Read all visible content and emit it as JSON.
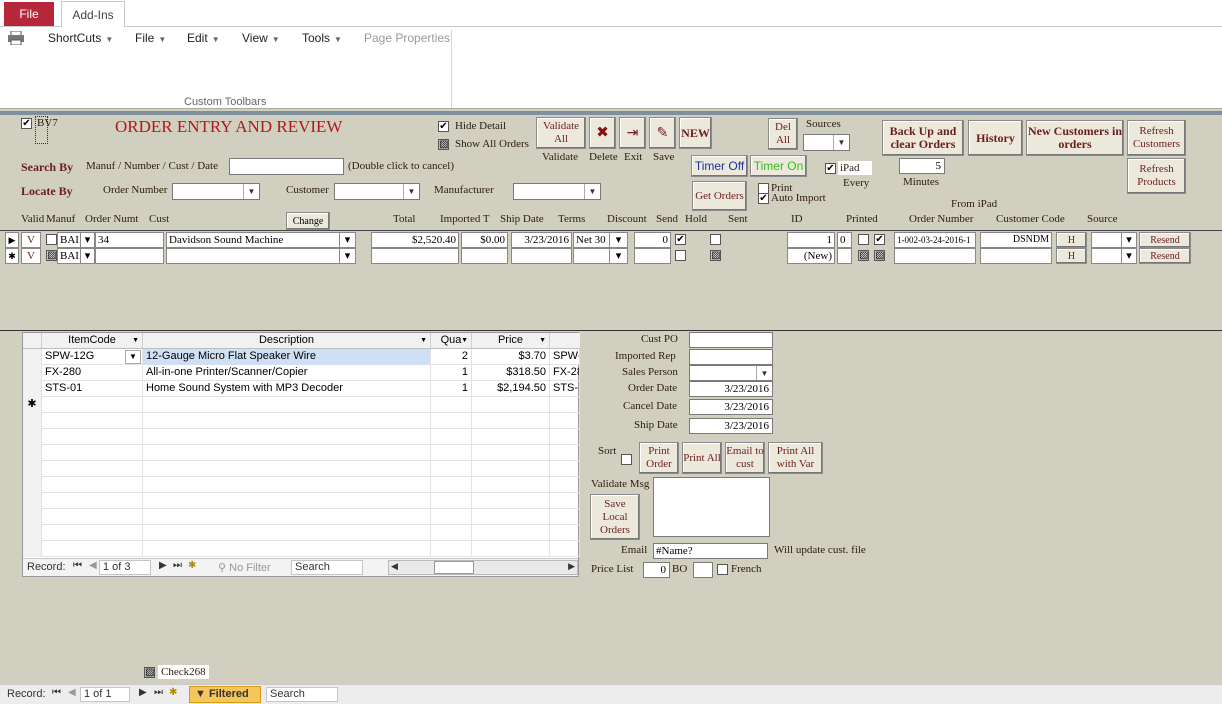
{
  "ribbon": {
    "file_tab": "File",
    "addins_tab": "Add-Ins",
    "menus": [
      "ShortCuts",
      "File",
      "Edit",
      "View",
      "Tools"
    ],
    "page_properties": "Page Properties",
    "group_label": "Custom Toolbars"
  },
  "form": {
    "bv7": "BV7",
    "title": "ORDER ENTRY AND REVIEW",
    "search_by": "Search By",
    "search_hint": "Manuf / Number / Cust / Date",
    "search_value": "",
    "search_note": "(Double click to cancel)",
    "locate_by": "Locate By",
    "order_number_lbl": "Order Number",
    "customer_lbl": "Customer",
    "manufacturer_lbl": "Manufacturer",
    "hide_detail": "Hide Detail",
    "show_all_orders": "Show All Orders",
    "validate_all": "Validate All",
    "new_btn": "NEW",
    "action_labels": [
      "Validate",
      "Delete",
      "Exit",
      "Save"
    ],
    "del_all": "Del All",
    "sources": "Sources",
    "timer_off": "Timer Off",
    "timer_on": "Timer On",
    "ipad": "iPad",
    "every": "Every",
    "minutes_value": "5",
    "minutes": "Minutes",
    "get_orders": "Get Orders",
    "print": "Print",
    "auto_import": "Auto Import",
    "backup": "Back Up and clear Orders",
    "history": "History",
    "new_customers": "New Customers in orders",
    "refresh_customers": "Refresh Customers",
    "refresh_products": "Refresh Products",
    "change_btn": "Change",
    "from_ipad": "From iPad"
  },
  "grid": {
    "headers": {
      "valid": "Valid",
      "manuf": "Manuf",
      "order_num": "Order Numt",
      "cust": "Cust",
      "total": "Total",
      "imported": "Imported T",
      "ship_date": "Ship Date",
      "terms": "Terms",
      "discount": "Discount",
      "send": "Send",
      "hold": "Hold",
      "sent": "Sent",
      "id": "ID",
      "printed": "Printed",
      "order_number": "Order Number",
      "customer_code": "Customer Code",
      "source": "Source"
    },
    "rows": [
      {
        "valid": "V",
        "manuf": "BAI",
        "order_num": "34",
        "cust": "Davidson Sound Machine",
        "total": "$2,520.40",
        "imported": "$0.00",
        "ship_date": "3/23/2016",
        "terms": "Net 30",
        "discount": "0",
        "id": "1",
        "printed": "0",
        "order_number": "1-002-03-24-2016-1",
        "customer_code": "DSNDM",
        "h": "H",
        "resend": "Resend"
      },
      {
        "valid": "V",
        "manuf": "BAI",
        "order_num": "",
        "cust": "",
        "total": "",
        "imported": "",
        "ship_date": "",
        "terms": "",
        "discount": "",
        "id": "(New)",
        "printed": "",
        "order_number": "",
        "customer_code": "",
        "h": "H",
        "resend": "Resend"
      }
    ]
  },
  "subform": {
    "headers": [
      "ItemCode",
      "Description",
      "Qua",
      "Price"
    ],
    "rows": [
      {
        "code": "SPW-12G",
        "desc": "12-Gauge Micro Flat Speaker Wire",
        "qty": "2",
        "price": "$3.70",
        "extra": "SPW-"
      },
      {
        "code": "FX-280",
        "desc": "All-in-one Printer/Scanner/Copier",
        "qty": "1",
        "price": "$318.50",
        "extra": "FX-28"
      },
      {
        "code": "STS-01",
        "desc": "Home Sound System with MP3 Decoder",
        "qty": "1",
        "price": "$2,194.50",
        "extra": "STS-"
      }
    ],
    "nav": {
      "record": "Record:",
      "pos": "1 of 3",
      "filter": "No Filter",
      "search": "Search"
    }
  },
  "detail": {
    "cust_po": "Cust PO",
    "imported_rep": "Imported Rep",
    "sales_person": "Sales Person",
    "order_date": "Order Date",
    "order_date_value": "3/23/2016",
    "cancel_date": "Cancel Date",
    "cancel_date_value": "3/23/2016",
    "ship_date": "Ship Date",
    "ship_date_value": "3/23/2016",
    "sort": "Sort",
    "print_order": "Print Order",
    "print_all": "Print All",
    "email_to_cust": "Email to cust",
    "print_all_var": "Print All with Var",
    "validate_msg": "Validate Msg",
    "save_local": "Save Local Orders",
    "email": "Email",
    "email_value": "#Name?",
    "will_update": "Will update cust. file",
    "price_list": "Price List",
    "price_list_value": "0",
    "bo": "BO",
    "french": "French"
  },
  "check268": "Check268",
  "bottom_nav": {
    "record": "Record:",
    "pos": "1 of 1",
    "filtered": "Filtered",
    "search": "Search"
  }
}
